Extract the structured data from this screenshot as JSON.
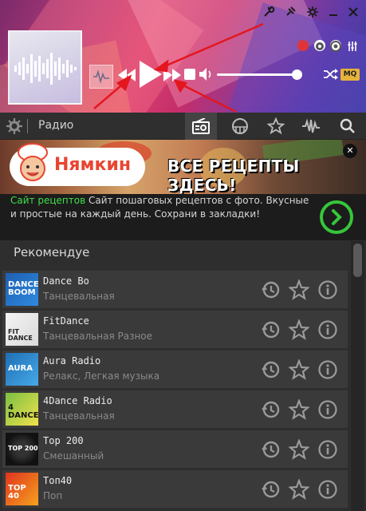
{
  "nav": {
    "title": "Радио"
  },
  "ad": {
    "brand": "Нямкин",
    "headline": "ВСЕ РЕЦЕПТЫ ЗДЕСЬ!",
    "link_text": "Сайт рецептов",
    "description": " Сайт пошаговых рецептов с фото. Вкусные и простые на каждый день. Сохрани в закладки!",
    "close_label": "✕"
  },
  "player": {
    "quality_badge": "MQ"
  },
  "recommended": {
    "title": "Рекомендуем",
    "stations": [
      {
        "name": "Dance Bo",
        "genre": "Танцевальная",
        "logo_text": "DANCE BOOM"
      },
      {
        "name": "FitDance",
        "genre": "Танцевальная Разное",
        "logo_text": "FIT DANCE"
      },
      {
        "name": "Aura Radio",
        "genre": "Релакс, Легкая музыка",
        "logo_text": "AURA"
      },
      {
        "name": "4Dance Radio",
        "genre": "Танцевальная",
        "logo_text": "4 DANCE"
      },
      {
        "name": "Top 200",
        "genre": "Смешанный",
        "logo_text": "TOP 200"
      },
      {
        "name": "Топ40",
        "genre": "Поп",
        "logo_text": "TOP 40"
      }
    ]
  },
  "colors": {
    "accent_green": "#3ee04a",
    "mq_badge": "#e7b23a",
    "record_red": "#e0343a"
  }
}
